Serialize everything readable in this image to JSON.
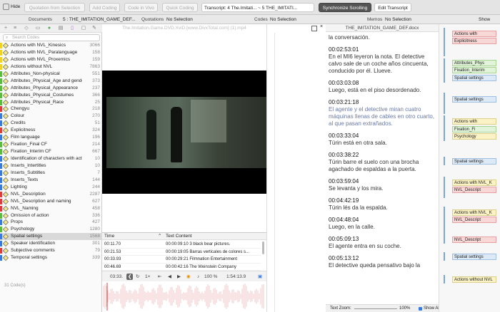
{
  "toolbar": {
    "hide": "Hide",
    "quotation_from_selection": "Quotation from Selection",
    "add_coding": "Add Coding",
    "code_in_vivo": "Code in Vivo",
    "quick_coding": "Quick Coding",
    "transcript_select": "Transcript: 4 The.Imitati... ~ 5 THE_IMITATI...",
    "synchronize_scrolling": "Synchronize Scrolling",
    "edit_transcript": "Edit Transcript"
  },
  "row2": {
    "documents_label": "Documents",
    "document_value": "5 : THE_IMITATION_GAME_DEF...",
    "quotations_label": "Quotations",
    "quotations_value": "No Selection",
    "codes_label": "Codes",
    "codes_value": "No Selection",
    "memos_label": "Memos",
    "memos_value": "No Selection",
    "show": "Show"
  },
  "search": {
    "placeholder": "Search Codes"
  },
  "codes": [
    {
      "name": "Actions with NVL_Kinesics",
      "count": "3066",
      "color": "#f5d21f"
    },
    {
      "name": "Actions with NVL_Paralanguage",
      "count": "158",
      "color": "#f5d21f"
    },
    {
      "name": "Actions with NVL_Proxemics",
      "count": "159",
      "color": "#f5d21f"
    },
    {
      "name": "Actions without NVL",
      "count": "7863",
      "color": "#f5d21f"
    },
    {
      "name": "Attributes_Non-physical",
      "count": "551",
      "color": "#5bbd3e"
    },
    {
      "name": "Attributes_Physical_Age and gender",
      "count": "373",
      "color": "#5bbd3e"
    },
    {
      "name": "Attributes_Physical_Appearance",
      "count": "237",
      "color": "#5bbd3e"
    },
    {
      "name": "Attributes_Physical_Costumes",
      "count": "366",
      "color": "#5bbd3e"
    },
    {
      "name": "Attributes_Physical_Race",
      "count": "25",
      "color": "#5bbd3e"
    },
    {
      "name": "Chengyu",
      "count": "218",
      "color": "#e33b3b"
    },
    {
      "name": "Colour",
      "count": "270",
      "color": "#3a7ae0"
    },
    {
      "name": "Credits",
      "count": "51",
      "color": "#3a7ae0"
    },
    {
      "name": "Explicitness",
      "count": "324",
      "color": "#e33b3b"
    },
    {
      "name": "Film language",
      "count": "196",
      "color": "#3a7ae0"
    },
    {
      "name": "Fixation_Final CF",
      "count": "214",
      "color": "#5bbd3e"
    },
    {
      "name": "Fixation_Interim CF",
      "count": "667",
      "color": "#5bbd3e"
    },
    {
      "name": "Identification of characters with actors",
      "count": "10",
      "color": "#3a7ae0"
    },
    {
      "name": "Inserts_Intertitles",
      "count": "10",
      "color": "#3a7ae0"
    },
    {
      "name": "Inserts_Subtitles",
      "count": "7",
      "color": "#3a7ae0"
    },
    {
      "name": "Inserts_Texts",
      "count": "144",
      "color": "#3a7ae0"
    },
    {
      "name": "Lighting",
      "count": "244",
      "color": "#3a7ae0"
    },
    {
      "name": "NVL_Description",
      "count": "2287",
      "color": "#e33b3b"
    },
    {
      "name": "NVL_Description and naming",
      "count": "627",
      "color": "#e33b3b"
    },
    {
      "name": "NVL_Naming",
      "count": "458",
      "color": "#e33b3b"
    },
    {
      "name": "Omission of action",
      "count": "336",
      "color": "#5bbd3e"
    },
    {
      "name": "Props",
      "count": "427",
      "color": "#3a7ae0"
    },
    {
      "name": "Psychology",
      "count": "1280",
      "color": "#5bbd3e"
    },
    {
      "name": "Spatial settings",
      "count": "1568",
      "color": "#3a7ae0"
    },
    {
      "name": "Speaker identification",
      "count": "301",
      "color": "#3a7ae0"
    },
    {
      "name": "Subjective comments",
      "count": "79",
      "color": "#e33b3b"
    },
    {
      "name": "Temporal settings",
      "count": "339",
      "color": "#3a7ae0"
    }
  ],
  "code_count": "31 Code(s)",
  "video": {
    "title": "The.Imitation.Game.DVD.XviD.[www.DivxTotal.com] (1).mp4"
  },
  "table": {
    "col_time": "Time",
    "col_text": "Text Content",
    "rows": [
      {
        "time": "00:11.70",
        "text": "00:00:09:10 3 black bear pictures."
      },
      {
        "time": "00:21.53",
        "text": "00:00:19:05 Barras verticales de colores s..."
      },
      {
        "time": "00:33.93",
        "text": "00:00:29:21 Filmnation Entertainment"
      },
      {
        "time": "00:46.69",
        "text": "00:00:42:16 The Weinstein Company"
      }
    ]
  },
  "player": {
    "position": "03:33.",
    "speed": "1×",
    "volume": "100 %",
    "duration": "1:54:13.9"
  },
  "doc": {
    "title": "THE_IMITATION_GAME_DEF.docx",
    "blocks": [
      {
        "ts": "",
        "text": "la conversación.",
        "hl": false
      },
      {
        "ts": "00:02:53:01",
        "text": "En el MI6 leyeron la nota. El detective calvo sale de un coche años cincuenta, conducido por él. Llueve.",
        "hl": false
      },
      {
        "ts": "00:03:03:08",
        "text": "Luego, está en el piso desordenado.",
        "hl": false
      },
      {
        "ts": "00:03:21:18",
        "text": "El agente y el detective miran cuatro máquinas llenas de cables en otro cuarto, al que pasan extrañados.",
        "hl": true
      },
      {
        "ts": "00:03:33:04",
        "text": "Túrin está en otra sala.",
        "hl": false
      },
      {
        "ts": "00:03:38:22",
        "text": "Túrin barre el suelo con una brocha agachado de espaldas a la puerta.",
        "hl": false
      },
      {
        "ts": "00:03:59:04",
        "text": "Se levanta y los mira.",
        "hl": false
      },
      {
        "ts": "00:04:42:19",
        "text": "Túrin lés da la espalda.",
        "hl": false
      },
      {
        "ts": "00:04:48:04",
        "text": "Luego, en la calle.",
        "hl": false
      },
      {
        "ts": "00:05:09:13",
        "text": "El agente entra en su coche.",
        "hl": false
      },
      {
        "ts": "00:05:13:12",
        "text": "El detective queda pensativo bajo la",
        "hl": false
      }
    ],
    "zoom_label": "Text Zoom:",
    "zoom_value": "100%",
    "show_all": "Show All Quotations"
  },
  "margin": [
    {
      "label": "Actions with",
      "kind": "red",
      "row": 0
    },
    {
      "label": "Explicitness",
      "kind": "red",
      "row": 1
    },
    {
      "label": "Attributes_Phys",
      "kind": "green",
      "row": 2
    },
    {
      "label": "Fixation_Interim",
      "kind": "green",
      "row": 3
    },
    {
      "label": "Spatial settings",
      "kind": "blue",
      "row": 4
    },
    {
      "label": "Spatial settings",
      "kind": "blue",
      "row": 5
    },
    {
      "label": "Actions with",
      "kind": "yellow",
      "row": 6
    },
    {
      "label": "Fixation_Fi",
      "kind": "green",
      "row": 7
    },
    {
      "label": "Psychology",
      "kind": "yellow",
      "row": 8
    },
    {
      "label": "Spatial settings",
      "kind": "blue",
      "row": 9
    },
    {
      "label": "Actions with NVL_K",
      "kind": "yellow",
      "row": 10
    },
    {
      "label": "NVL_Descript",
      "kind": "red",
      "row": 11
    },
    {
      "label": "Actions with NVL_K",
      "kind": "yellow",
      "row": 12
    },
    {
      "label": "NVL_Descript",
      "kind": "red",
      "row": 13
    },
    {
      "label": "NVL_Descript",
      "kind": "red",
      "row": 14
    },
    {
      "label": "Spatial settings",
      "kind": "blue",
      "row": 15
    },
    {
      "label": "Actions without NVL",
      "kind": "yellow",
      "row": 16
    }
  ]
}
